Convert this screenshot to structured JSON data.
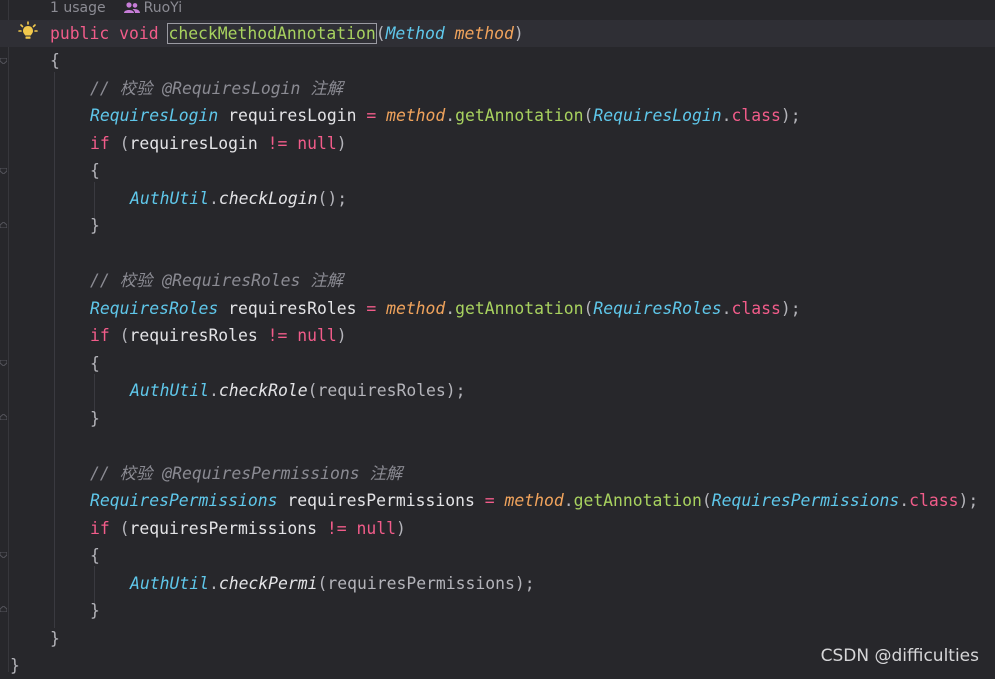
{
  "inlay": {
    "usage": "1 usage",
    "author": "RuoYi"
  },
  "icons": {
    "bulb": "lightbulb-icon",
    "author": "users-icon"
  },
  "colors": {
    "keyword": "#f25c8a",
    "class": "#5fc7ea",
    "param": "#f0a35c",
    "method": "#a8d25f",
    "comment": "#8b8b93",
    "text": "#e3e3e6",
    "background": "#27272b"
  },
  "code": {
    "l1": {
      "kw1": "public",
      "kw2": "void",
      "name": "checkMethodAnnotation",
      "open": "(",
      "ptype": "Method",
      "pname": "method",
      "close": ")"
    },
    "l2": "{",
    "l3": "// 校验 @RequiresLogin 注解",
    "l4": {
      "type": "RequiresLogin",
      "var": " requiresLogin ",
      "eq": "=",
      "recv": "method",
      "call": "getAnnotation",
      "argcls": "RequiresLogin",
      "dot": ".",
      "kwclass": "class",
      "end": ");"
    },
    "l5": {
      "kwif": "if",
      "open": " (",
      "var": "requiresLogin ",
      "op": "!=",
      "nul": "null",
      "close": ")"
    },
    "l6": "{",
    "l7": {
      "cls": "AuthUtil",
      "dot": ".",
      "fn": "checkLogin",
      "args": "();"
    },
    "l8": "}",
    "l10": "// 校验 @RequiresRoles 注解",
    "l11": {
      "type": "RequiresRoles",
      "var": " requiresRoles ",
      "eq": "=",
      "recv": "method",
      "call": "getAnnotation",
      "argcls": "RequiresRoles",
      "dot": ".",
      "kwclass": "class",
      "end": ");"
    },
    "l12": {
      "kwif": "if",
      "open": " (",
      "var": "requiresRoles ",
      "op": "!=",
      "nul": "null",
      "close": ")"
    },
    "l13": "{",
    "l14": {
      "cls": "AuthUtil",
      "dot": ".",
      "fn": "checkRole",
      "args": "(requiresRoles);"
    },
    "l15": "}",
    "l17": "// 校验 @RequiresPermissions 注解",
    "l18": {
      "type": "RequiresPermissions",
      "var": " requiresPermissions ",
      "eq": "=",
      "recv": "method",
      "call": "getAnnotation",
      "argcls": "RequiresPermissions",
      "dot": ".",
      "kwclass": "class",
      "end": ");"
    },
    "l19": {
      "kwif": "if",
      "open": " (",
      "var": "requiresPermissions ",
      "op": "!=",
      "nul": "null",
      "close": ")"
    },
    "l20": "{",
    "l21": {
      "cls": "AuthUtil",
      "dot": ".",
      "fn": "checkPermi",
      "args": "(requiresPermissions);"
    },
    "l22": "}",
    "l23": "}",
    "l24": "}"
  },
  "watermark": "CSDN @difficulties"
}
